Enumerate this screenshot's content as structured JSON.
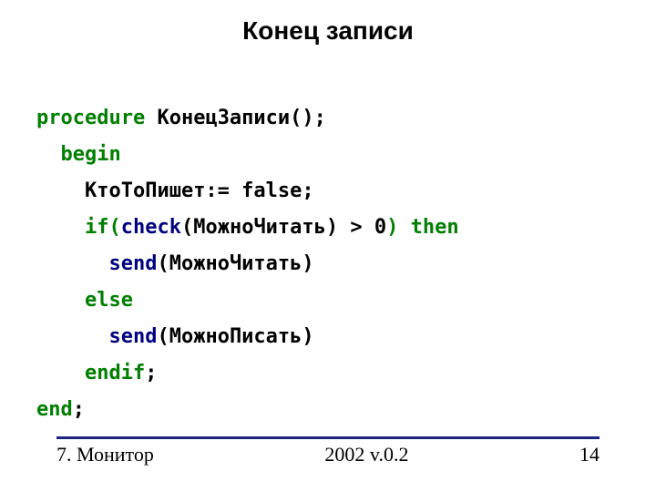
{
  "title": "Конец записи",
  "code": {
    "l1_kw": "procedure",
    "l1_rest": " КонецЗаписи();",
    "l2_kw": "begin",
    "l3": "КтоТоПишет:= false;",
    "l4_if": "if",
    "l4_lpar": "(",
    "l4_check": "check",
    "l4_mid": "(МожноЧитать) > 0",
    "l4_rpar": ")",
    "l4_then": " then",
    "l5_send": "send",
    "l5_arg": "(МожноЧитать)",
    "l6_else": "else",
    "l7_send": "send",
    "l7_arg": "(МожноПисать)",
    "l8_endif": "endif",
    "l8_semi": ";",
    "l9_end": "end",
    "l9_semi": ";"
  },
  "footer": {
    "left": "7. Монитор",
    "mid": "2002 v.0.2",
    "right": "14"
  }
}
